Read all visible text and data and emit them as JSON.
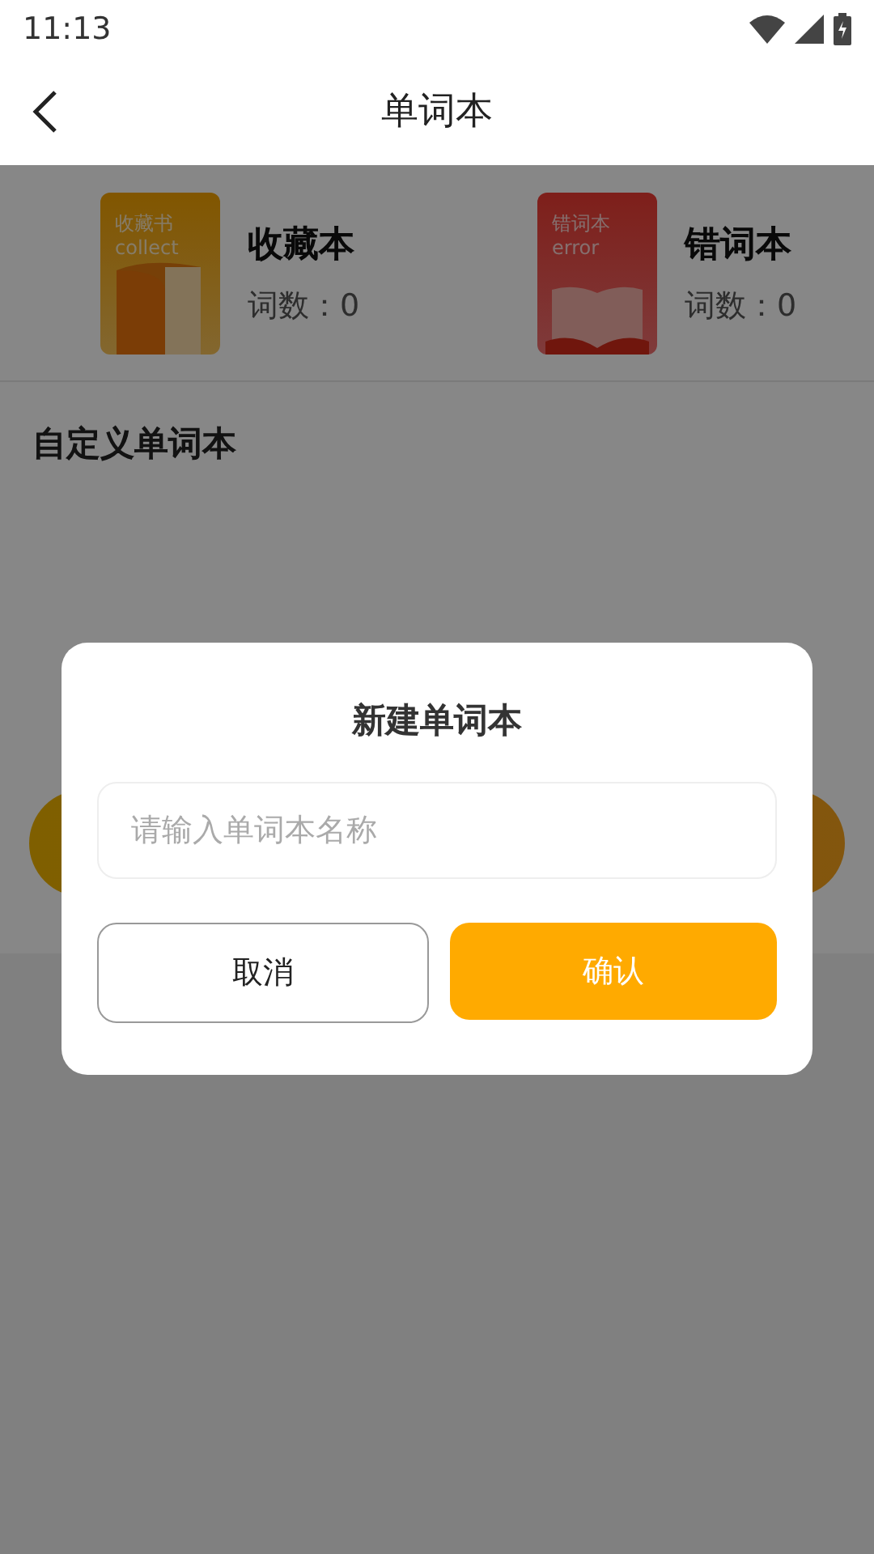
{
  "status_bar": {
    "time": "11:13"
  },
  "header": {
    "title": "单词本"
  },
  "books": [
    {
      "kind": "collect",
      "cover_title": "收藏书",
      "cover_subtitle": "collect",
      "name": "收藏本",
      "count": "词数：0"
    },
    {
      "kind": "error",
      "cover_title": "错词本",
      "cover_subtitle": "error",
      "name": "错词本",
      "count": "词数：0"
    }
  ],
  "section_title": "自定义单词本",
  "dialog": {
    "title": "新建单词本",
    "placeholder": "请输入单词本名称",
    "buttons": [
      {
        "kind": "secondary",
        "label": "取消"
      },
      {
        "kind": "primary",
        "label": "确认"
      }
    ]
  }
}
